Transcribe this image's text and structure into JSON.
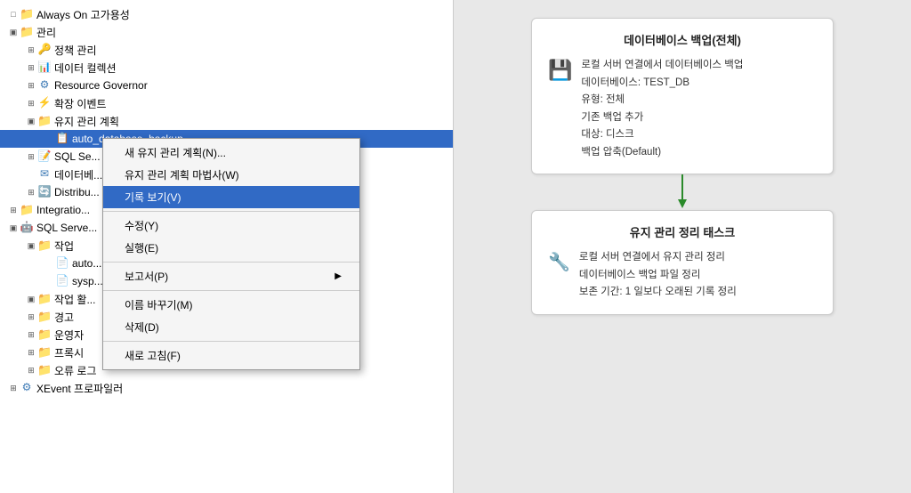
{
  "tree": {
    "items": [
      {
        "id": "always-on",
        "label": "Always On 고가용성",
        "indent": 1,
        "expand": "□",
        "iconType": "folder",
        "level": 24
      },
      {
        "id": "manage",
        "label": "관리",
        "indent": 1,
        "expand": "▣",
        "iconType": "folder",
        "level": 24
      },
      {
        "id": "policy",
        "label": "정책 관리",
        "indent": 2,
        "expand": "⊞",
        "iconType": "policy",
        "level": 44
      },
      {
        "id": "datacollect",
        "label": "데이터 컬렉션",
        "indent": 2,
        "expand": "⊞",
        "iconType": "datacollect",
        "level": 44
      },
      {
        "id": "resource-gov",
        "label": "Resource Governor",
        "indent": 2,
        "expand": "⊞",
        "iconType": "resource",
        "level": 44
      },
      {
        "id": "expand-events",
        "label": "확장 이벤트",
        "indent": 2,
        "expand": "⊞",
        "iconType": "expand",
        "level": 44
      },
      {
        "id": "maint-plans",
        "label": "유지 관리 계획",
        "indent": 2,
        "expand": "▣",
        "iconType": "folder",
        "level": 44
      },
      {
        "id": "auto-plan",
        "label": "auto_database_backup",
        "indent": 3,
        "expand": "",
        "iconType": "plan",
        "level": 64,
        "selected": true
      },
      {
        "id": "sql-server-logs",
        "label": "SQL Se...",
        "indent": 2,
        "expand": "⊞",
        "iconType": "resource",
        "level": 44
      },
      {
        "id": "database-mail",
        "label": "데이터베...",
        "indent": 2,
        "expand": "",
        "iconType": "datacollect",
        "level": 44
      },
      {
        "id": "distribute",
        "label": "Distribu...",
        "indent": 2,
        "expand": "⊞",
        "iconType": "distribute",
        "level": 44
      },
      {
        "id": "integration",
        "label": "Integratio...",
        "indent": 1,
        "expand": "⊞",
        "iconType": "folder",
        "level": 24
      },
      {
        "id": "sql-server-agent",
        "label": "SQL Serve...",
        "indent": 1,
        "expand": "▣",
        "iconType": "agent",
        "level": 24
      },
      {
        "id": "jobs",
        "label": "작업",
        "indent": 2,
        "expand": "▣",
        "iconType": "folder",
        "level": 44
      },
      {
        "id": "job-auto",
        "label": "auto...",
        "indent": 3,
        "expand": "",
        "iconType": "job",
        "level": 64
      },
      {
        "id": "job-sysp",
        "label": "sysp...",
        "indent": 3,
        "expand": "",
        "iconType": "job",
        "level": 64
      },
      {
        "id": "job-history",
        "label": "작업 활...",
        "indent": 2,
        "expand": "▣",
        "iconType": "folder",
        "level": 44
      },
      {
        "id": "alert",
        "label": "경고",
        "indent": 2,
        "expand": "⊞",
        "iconType": "folder",
        "level": 44
      },
      {
        "id": "operator",
        "label": "운영자",
        "indent": 2,
        "expand": "⊞",
        "iconType": "folder",
        "level": 44
      },
      {
        "id": "proxy",
        "label": "프록시",
        "indent": 2,
        "expand": "⊞",
        "iconType": "folder",
        "level": 44
      },
      {
        "id": "error-log",
        "label": "오류 로그",
        "indent": 2,
        "expand": "⊞",
        "iconType": "folder",
        "level": 44
      },
      {
        "id": "xevent-profiler",
        "label": "XEvent 프로파일러",
        "indent": 1,
        "expand": "⊞",
        "iconType": "resource",
        "level": 24
      }
    ]
  },
  "context_menu": {
    "items": [
      {
        "id": "new-maint",
        "label": "새 유지 관리 계획(N)...",
        "type": "item"
      },
      {
        "id": "maint-wizard",
        "label": "유지 관리 계획 마법사(W)",
        "type": "item"
      },
      {
        "id": "view-history",
        "label": "기록 보기(V)",
        "type": "item",
        "highlighted": true
      },
      {
        "id": "separator1",
        "type": "separator"
      },
      {
        "id": "modify",
        "label": "수정(Y)",
        "type": "item"
      },
      {
        "id": "execute",
        "label": "실행(E)",
        "type": "item"
      },
      {
        "id": "separator2",
        "type": "separator"
      },
      {
        "id": "report",
        "label": "보고서(P)",
        "type": "item",
        "hasArrow": true
      },
      {
        "id": "separator3",
        "type": "separator"
      },
      {
        "id": "rename",
        "label": "이름 바꾸기(M)",
        "type": "item"
      },
      {
        "id": "delete",
        "label": "삭제(D)",
        "type": "item"
      },
      {
        "id": "separator4",
        "type": "separator"
      },
      {
        "id": "refresh",
        "label": "새로 고침(F)",
        "type": "item"
      }
    ]
  },
  "right_panel": {
    "card1": {
      "title": "데이터베이스 백업(전체)",
      "icon": "💾",
      "lines": [
        "로컬 서버 연결에서 데이터베이스 백업",
        "데이터베이스: TEST_DB",
        "유형: 전체",
        "기존 백업 추가",
        "대상: 디스크",
        "백업 압축(Default)"
      ]
    },
    "card2": {
      "title": "유지 관리 정리 태스크",
      "icon": "🔧",
      "lines": [
        "로컬 서버 연결에서 유지 관리 정리",
        "데이터베이스 백업 파일 정리",
        "보존 기간: 1 일보다 오래된 기록 정리"
      ]
    }
  }
}
